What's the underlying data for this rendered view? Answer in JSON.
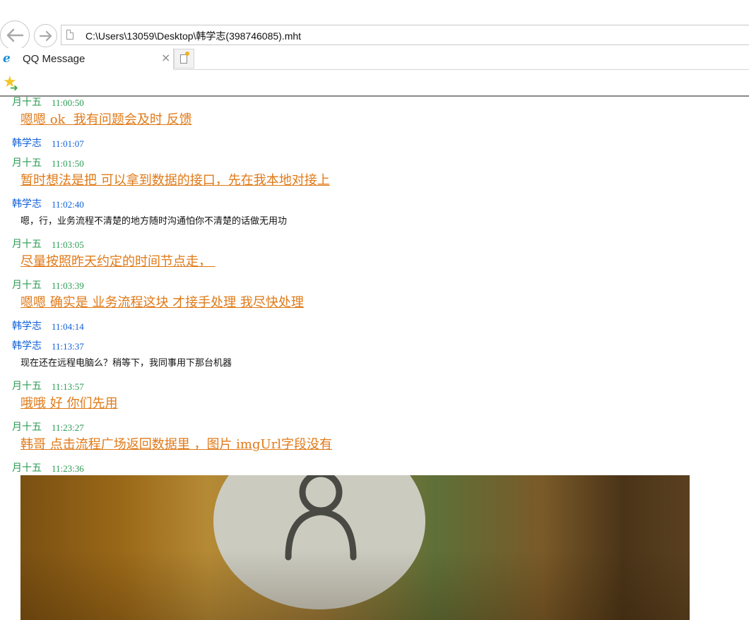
{
  "browser": {
    "address": "C:\\Users\\13059\\Desktop\\韩学志(398746085).mht",
    "tab_title": "QQ Message",
    "tab_close": "×"
  },
  "icons": {
    "back": "back-arrow-icon",
    "forward": "forward-arrow-icon",
    "page": "page-icon",
    "ie": "internet-explorer-icon",
    "new_tab": "new-tab-icon",
    "favorites": "add-favorites-star-icon"
  },
  "colors": {
    "peer_name": "#2a9a52",
    "self_name": "#1060d8",
    "peer_message": "#e07a18",
    "self_message": "#111111"
  },
  "messages": [
    {
      "sender": "月十五",
      "time": "11:00:50",
      "text": "嗯嗯 ok  我有问题会及时 反馈",
      "style": "orange"
    },
    {
      "sender": "韩学志",
      "time": "11:01:07"
    },
    {
      "sender": "月十五",
      "time": "11:01:50",
      "text": "暂时想法是把 可以拿到数据的接口，先在我本地对接上",
      "style": "orange"
    },
    {
      "sender": "韩学志",
      "time": "11:02:40",
      "text": "嗯，行，业务流程不清楚的地方随时沟通怕你不清楚的话做无用功",
      "style": "black"
    },
    {
      "sender": "月十五",
      "time": "11:03:05",
      "text": "尽量按照昨天约定的时间节点走， ",
      "style": "orange"
    },
    {
      "sender": "月十五",
      "time": "11:03:39",
      "text": "嗯嗯 确实是 业务流程这块 才接手处理 我尽快处理",
      "style": "orange"
    },
    {
      "sender": "韩学志",
      "time": "11:04:14"
    },
    {
      "sender": "韩学志",
      "time": "11:13:37",
      "text": "现在还在远程电脑么？稍等下，我同事用下那台机器",
      "style": "black"
    },
    {
      "sender": "月十五",
      "time": "11:13:57",
      "text": "哦哦 好 你们先用",
      "style": "orange"
    },
    {
      "sender": "月十五",
      "time": "11:23:27",
      "text": "韩哥 点击流程广场返回数据里 ，图片 imgUrl字段没有",
      "style": "orange"
    },
    {
      "sender": "月十五",
      "time": "11:23:36",
      "image": "user-avatar-photo"
    }
  ]
}
